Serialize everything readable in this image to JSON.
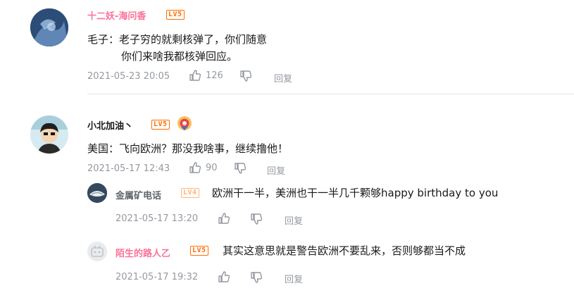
{
  "comments": [
    {
      "username": "十二妖-海问香",
      "level": "LV5",
      "lines": [
        "毛子：老子穷的就剩核弹了，你们随意",
        "你们来啥我都核弹回应。"
      ],
      "date": "2021-05-23 20:05",
      "likes": "126",
      "reply_label": "回复",
      "replies": []
    },
    {
      "username": "小北加油丶",
      "level": "LV5",
      "lines": [
        "美国：飞向欧洲？那没我啥事，继续撸他！"
      ],
      "date": "2021-05-17 12:43",
      "likes": "90",
      "reply_label": "回复",
      "replies": [
        {
          "username": "金属矿电话",
          "level": "LV4",
          "text": "欧洲干一半，美洲也干一半几千颗够happy birthday to you",
          "date": "2021-05-17 13:20",
          "reply_label": "回复"
        },
        {
          "username": "陌生的路人乙",
          "level": "LV5",
          "text": "其实这意思就是警告欧洲不要乱来，否则够都当不成",
          "date": "2021-05-17 19:32",
          "reply_label": "回复"
        }
      ]
    }
  ],
  "colors": {
    "pink_name": "#fb7299",
    "gray_name": "#61666d",
    "meta": "#9499a0",
    "lv5": "#ff6c00",
    "lv4": "#ffb37c"
  },
  "icons": [
    "thumb-up-icon",
    "thumb-down-icon",
    "fan-badge-icon"
  ]
}
